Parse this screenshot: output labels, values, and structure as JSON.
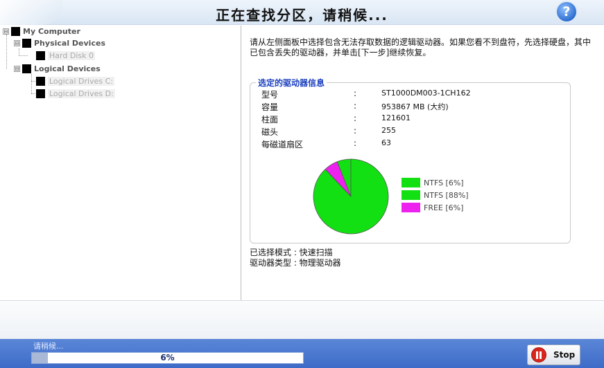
{
  "window": {
    "title": "正在查找分区，请稍候...",
    "help_icon": "help-icon",
    "help_glyph": "?"
  },
  "tree": {
    "root": {
      "label": "My Computer",
      "expander": "⊟",
      "icon": "computer-icon"
    },
    "physical": {
      "label": "Physical Devices",
      "expander": "⊟",
      "icon": "drive-group-icon"
    },
    "hard_disk": {
      "label": "Hard Disk 0",
      "icon": "hard-disk-icon"
    },
    "logical": {
      "label": "Logical Devices",
      "expander": "⊟",
      "icon": "drive-group-icon"
    },
    "logical_c": {
      "label": "Logical Drives C:",
      "icon": "logical-drive-icon"
    },
    "logical_d": {
      "label": "Logical Drives D:",
      "icon": "logical-drive-icon"
    }
  },
  "main": {
    "instruction": "请从左侧面板中选择包含无法存取数据的逻辑驱动器。如果您看不到盘符，先选择硬盘，其中已包含丢失的驱动器，并单击[下一步]继续恢复。",
    "info_title": "选定的驱动器信息",
    "info_rows": [
      {
        "key": "型号",
        "colon": ":",
        "value": "ST1000DM003-1CH162"
      },
      {
        "key": "容量",
        "colon": ":",
        "value": "953867 MB (大约)"
      },
      {
        "key": "柱面",
        "colon": ":",
        "value": "121601"
      },
      {
        "key": "磁头",
        "colon": ":",
        "value": "255"
      },
      {
        "key": "每磁道扇区",
        "colon": ":",
        "value": "63"
      }
    ],
    "mode_line": "已选择模式 : 快速扫描",
    "type_line": "驱动器类型    : 物理驱动器"
  },
  "chart_data": {
    "type": "pie",
    "slices": [
      {
        "label": "NTFS [6%]",
        "value": 6,
        "color": "#12e012"
      },
      {
        "label": "NTFS [88%]",
        "value": 88,
        "color": "#12e012"
      },
      {
        "label": "FREE [6%]",
        "value": 6,
        "color": "#ee22ee"
      }
    ]
  },
  "status": {
    "text": "请稍候...",
    "progress_label": "6%",
    "progress_value": 6,
    "stop_label": "Stop",
    "stop_icon": "stop-icon"
  }
}
